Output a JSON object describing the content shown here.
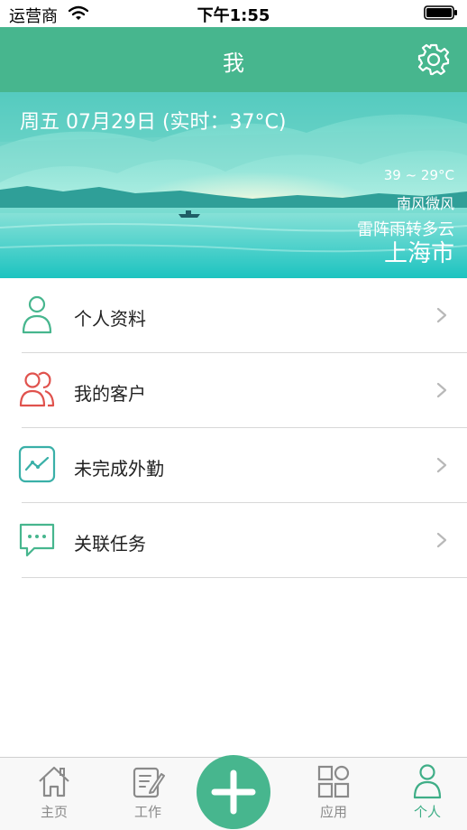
{
  "status_bar": {
    "carrier": "运营商",
    "time": "下午1:55"
  },
  "header": {
    "title": "我",
    "settings_icon": "gear-icon"
  },
  "weather": {
    "date_line": "周五 07月29日 (实时：37°C)",
    "temp_range": "39 ~ 29°C",
    "wind": "南风微风",
    "condition": "雷阵雨转多云",
    "city": "上海市"
  },
  "menu": {
    "items": [
      {
        "label": "个人资料",
        "icon": "person-icon",
        "color": "#47b68e"
      },
      {
        "label": "我的客户",
        "icon": "customers-icon",
        "color": "#e0524d"
      },
      {
        "label": "未完成外勤",
        "icon": "trend-chart-icon",
        "color": "#3ab0a8"
      },
      {
        "label": "关联任务",
        "icon": "chat-bubble-icon",
        "color": "#47b68e"
      }
    ]
  },
  "tabbar": {
    "tabs": [
      {
        "label": "主页",
        "icon": "home-icon",
        "active": false
      },
      {
        "label": "工作",
        "icon": "edit-note-icon",
        "active": false
      },
      {
        "label": "应用",
        "icon": "apps-grid-icon",
        "active": false
      },
      {
        "label": "个人",
        "icon": "person-icon",
        "active": true
      }
    ],
    "center_button_icon": "plus-icon"
  },
  "colors": {
    "brand": "#47b68e",
    "active_tab": "#3fae87",
    "inactive_tab": "#8a8a8a"
  }
}
